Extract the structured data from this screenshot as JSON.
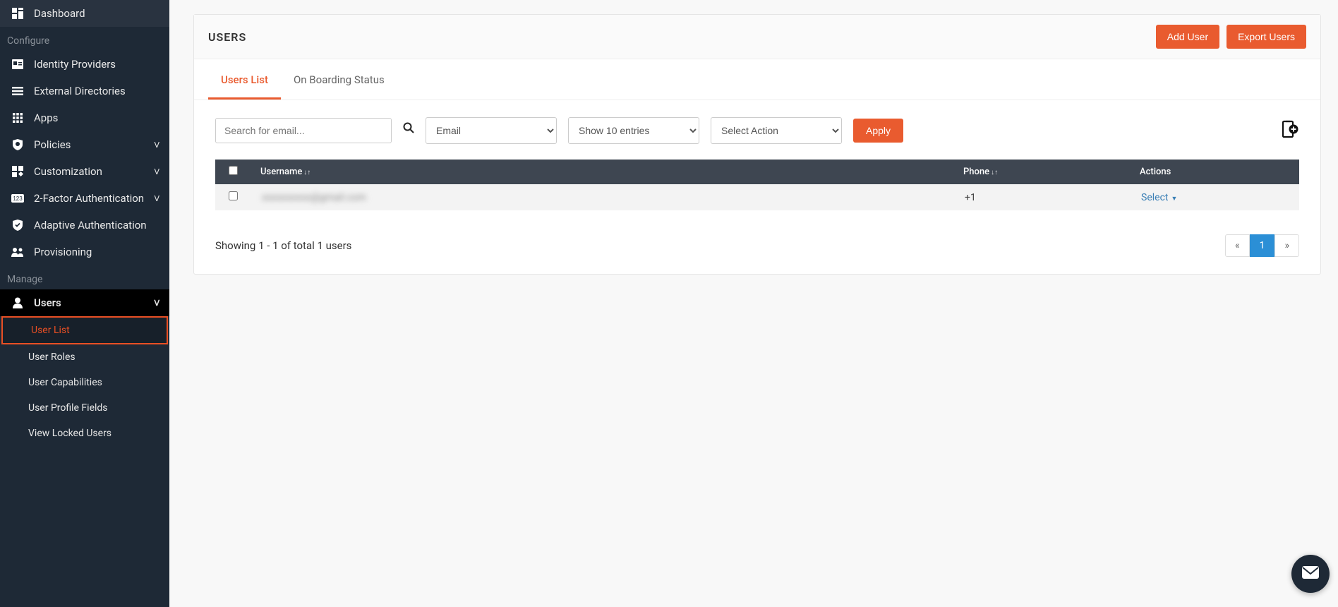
{
  "sidebar": {
    "top": {
      "label": "Dashboard"
    },
    "section_configure": "Configure",
    "items_configure": [
      {
        "label": "Identity Providers",
        "icon": "id-card"
      },
      {
        "label": "External Directories",
        "icon": "list"
      },
      {
        "label": "Apps",
        "icon": "grid"
      },
      {
        "label": "Policies",
        "icon": "shield",
        "expandable": true
      },
      {
        "label": "Customization",
        "icon": "puzzle",
        "expandable": true
      },
      {
        "label": "2-Factor Authentication",
        "icon": "123",
        "expandable": true
      },
      {
        "label": "Adaptive Authentication",
        "icon": "check-shield"
      },
      {
        "label": "Provisioning",
        "icon": "users-cog"
      }
    ],
    "section_manage": "Manage",
    "users_item": {
      "label": "Users"
    },
    "users_sub": [
      {
        "label": "User List"
      },
      {
        "label": "User Roles"
      },
      {
        "label": "User Capabilities"
      },
      {
        "label": "User Profile Fields"
      },
      {
        "label": "View Locked Users"
      }
    ]
  },
  "header": {
    "title": "USERS",
    "add_user": "Add User",
    "export_users": "Export Users"
  },
  "tabs": {
    "users_list": "Users List",
    "onboarding": "On Boarding Status"
  },
  "filters": {
    "search_placeholder": "Search for email...",
    "field_select": "Email",
    "entries_select": "Show 10 entries",
    "action_select": "Select Action",
    "apply": "Apply"
  },
  "table": {
    "columns": {
      "username": "Username",
      "phone": "Phone",
      "actions": "Actions"
    },
    "rows": [
      {
        "username_masked": "xxxxxxxxxx@gmail.com",
        "phone": "+1",
        "action": "Select"
      }
    ],
    "result_text": "Showing 1 - 1 of total 1 users"
  },
  "pagination": {
    "prev": "«",
    "page": "1",
    "next": "»"
  }
}
